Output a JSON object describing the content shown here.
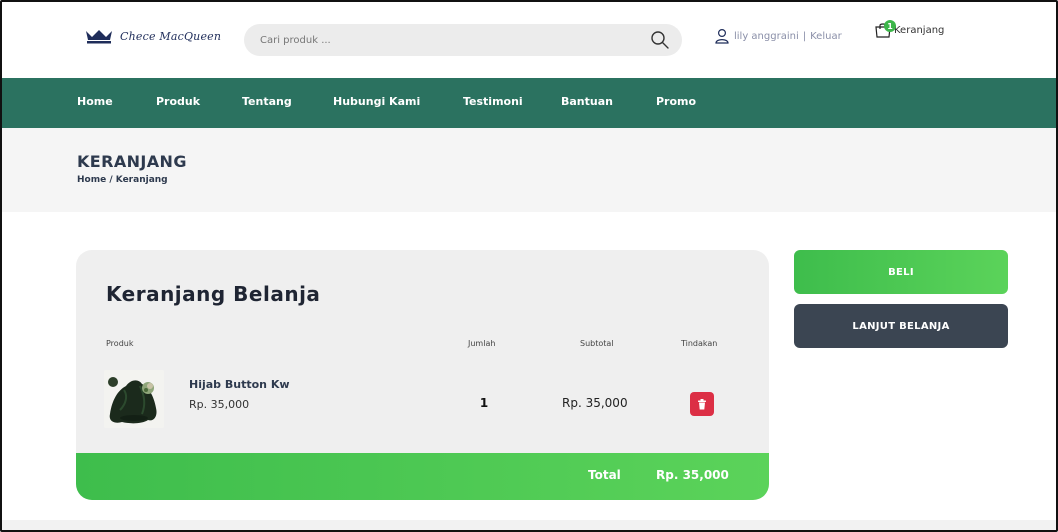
{
  "header": {
    "brand": "Chece MacQueen",
    "search_placeholder": "Cari produk ...",
    "user_name": "lily anggraini",
    "separator": "|",
    "logout_label": "Keluar",
    "cart_count": "1",
    "cart_label": "Keranjang"
  },
  "nav": {
    "items": [
      "Home",
      "Produk",
      "Tentang",
      "Hubungi Kami",
      "Testimoni",
      "Bantuan",
      "Promo"
    ]
  },
  "page": {
    "title": "KERANJANG",
    "breadcrumb_home": "Home",
    "breadcrumb_sep": " / ",
    "breadcrumb_current": "Keranjang"
  },
  "cart": {
    "title": "Keranjang Belanja",
    "columns": [
      "Produk",
      "Jumlah",
      "Subtotal",
      "Tindakan"
    ],
    "items": [
      {
        "name": "Hijab Button Kw",
        "price": "Rp. 35,000",
        "qty": "1",
        "subtotal": "Rp. 35,000",
        "image": "hijab-product-photo"
      }
    ],
    "total_label": "Total",
    "total_value": "Rp. 35,000"
  },
  "actions": {
    "buy_label": "BELI",
    "continue_label": "LANJUT BELANJA"
  },
  "colors": {
    "nav_bg": "#2b7260",
    "accent_green": "#4cc653",
    "dark_button": "#3b4552",
    "delete_red": "#dc2f45",
    "card_bg": "#efefef"
  }
}
